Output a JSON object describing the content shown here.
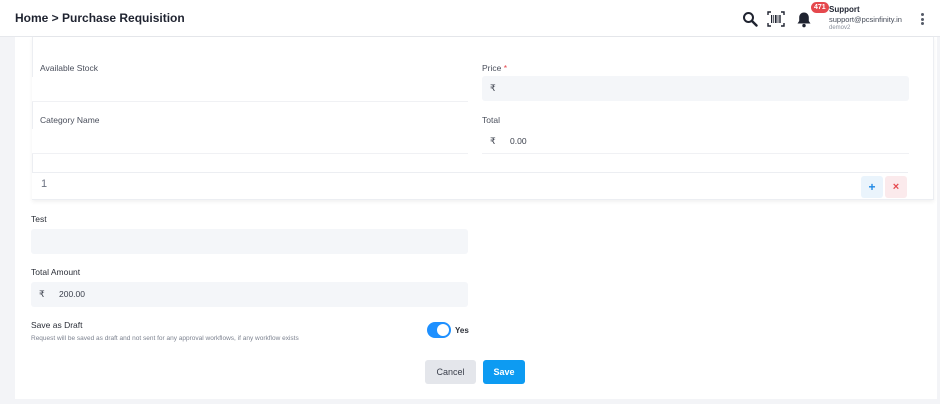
{
  "header": {
    "breadcrumb": "Home > Purchase Requisition",
    "notification_count": "471",
    "user": {
      "name": "Support",
      "email": "support@pcsinfinity.in",
      "org": "demov2"
    },
    "icons": [
      "search-icon",
      "barcode-scan-icon",
      "bell-icon",
      "more-vertical-icon"
    ]
  },
  "item_card": {
    "available_stock": {
      "label": "Available Stock",
      "value": ""
    },
    "price": {
      "label": "Price",
      "required_mark": "*",
      "currency": "₹",
      "value": ""
    },
    "category_name": {
      "label": "Category Name",
      "value": ""
    },
    "total": {
      "label": "Total",
      "currency": "₹",
      "value": "0.00"
    },
    "row_number": "1",
    "add_label": "+",
    "remove_label": "×"
  },
  "form": {
    "test": {
      "label": "Test",
      "value": ""
    },
    "total_amount": {
      "label": "Total Amount",
      "currency": "₹",
      "value": "200.00"
    },
    "save_as_draft": {
      "label": "Save as Draft",
      "hint": "Request will be saved as draft and not sent for any approval workflows, if any workflow exists",
      "toggle_label": "Yes",
      "checked": true
    }
  },
  "actions": {
    "cancel": "Cancel",
    "save": "Save"
  },
  "colors": {
    "accent": "#0d9bf2",
    "danger": "#e5484d"
  }
}
